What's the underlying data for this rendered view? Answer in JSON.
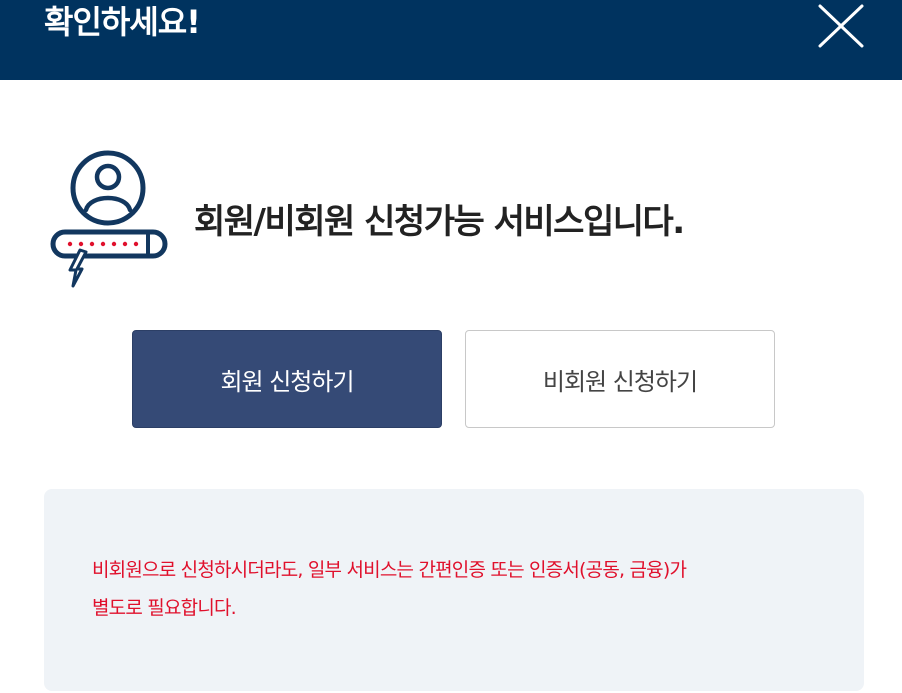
{
  "dialog": {
    "title": "확인하세요!",
    "close_icon": "close-x-icon"
  },
  "info": {
    "icon": "user-password-login-icon",
    "message": "회원/비회원 신청가능 서비스입니다."
  },
  "buttons": {
    "member_label": "회원 신청하기",
    "guest_label": "비회원 신청하기"
  },
  "notice": {
    "line1": "비회원으로 신청하시더라도, 일부 서비스는 간편인증 또는 인증서(공동, 금융)가",
    "line2": "별도로 필요합니다."
  },
  "colors": {
    "header_bg": "#00335f",
    "primary_button": "#354a76",
    "notice_bg": "#eff3f7",
    "notice_text": "#e0102c",
    "icon_navy": "#12375f"
  }
}
